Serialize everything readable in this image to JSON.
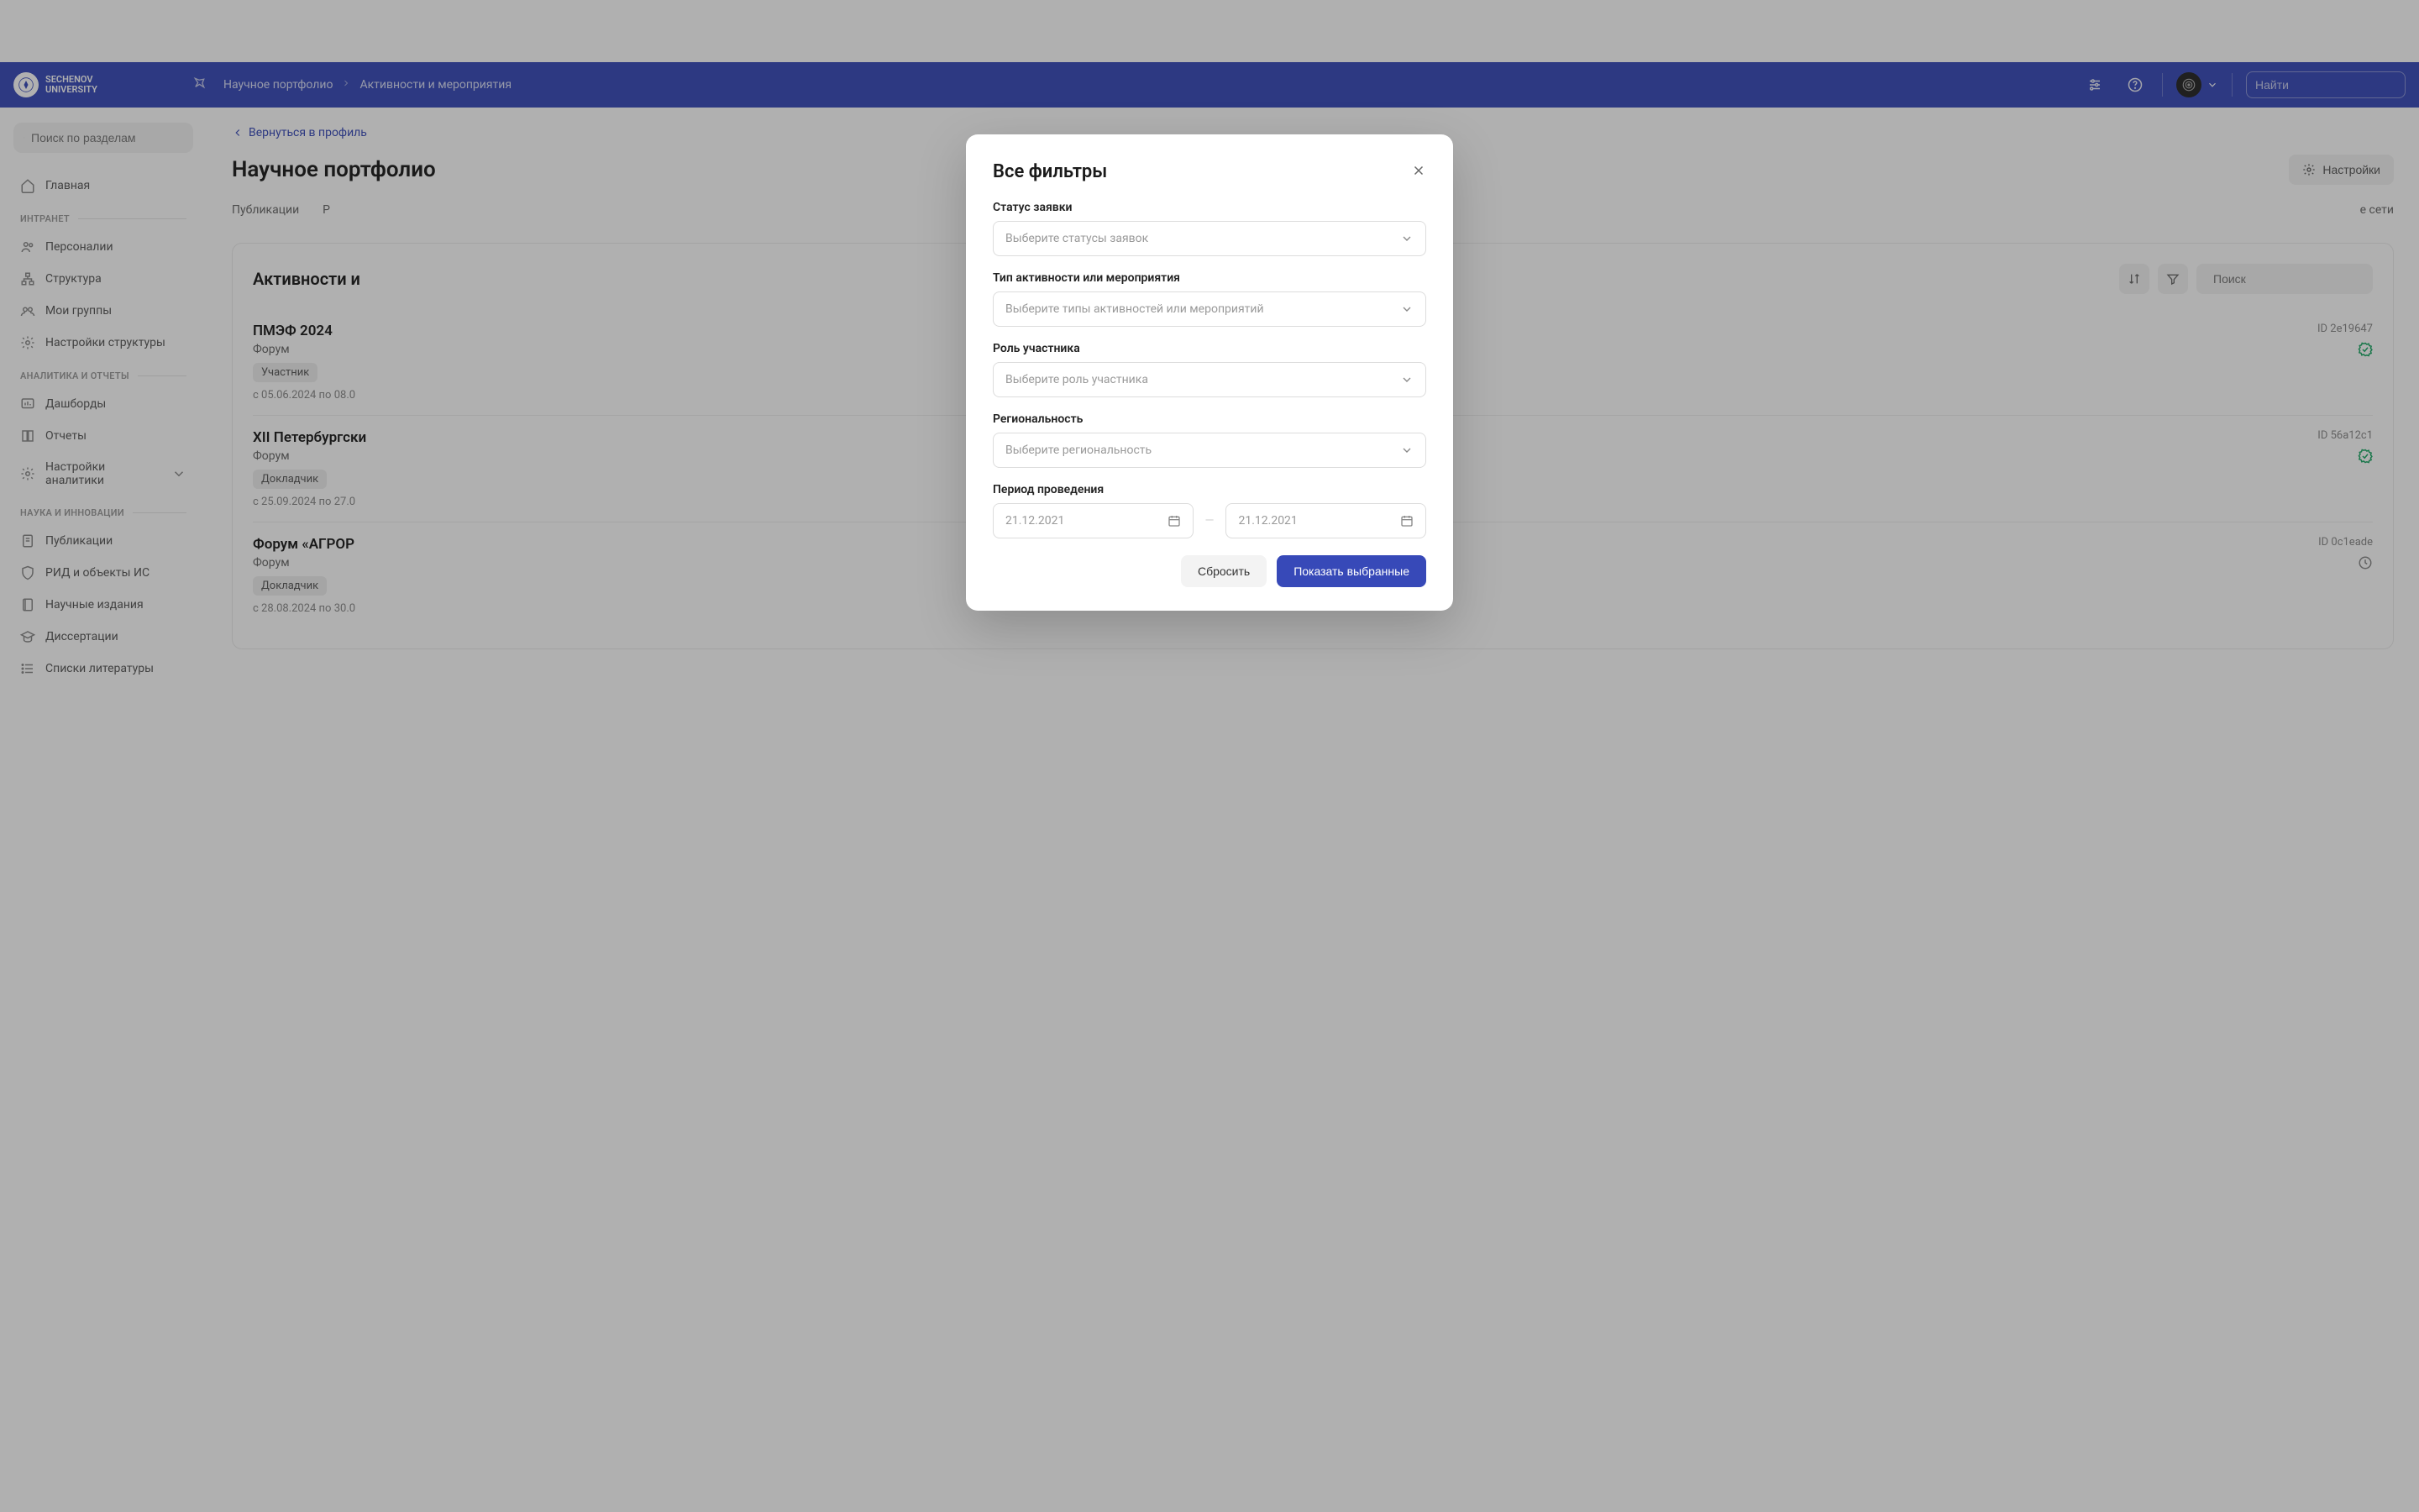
{
  "header": {
    "logo_line1": "SECHENOV",
    "logo_line2": "UNIVERSITY",
    "breadcrumbs": [
      "Научное портфолио",
      "Активности и мероприятия"
    ],
    "search_placeholder": "Найти"
  },
  "sidebar": {
    "search_placeholder": "Поиск по разделам",
    "items_top": [
      {
        "label": "Главная",
        "icon": "home"
      }
    ],
    "section_intranet": "ИНТРАНЕТ",
    "items_intranet": [
      {
        "label": "Персоналии",
        "icon": "users"
      },
      {
        "label": "Структура",
        "icon": "sitemap"
      },
      {
        "label": "Мои группы",
        "icon": "groups"
      },
      {
        "label": "Настройки структуры",
        "icon": "gear"
      }
    ],
    "section_analytics": "АНАЛИТИКА И ОТЧЕТЫ",
    "items_analytics": [
      {
        "label": "Дашборды",
        "icon": "dashboard"
      },
      {
        "label": "Отчеты",
        "icon": "book"
      },
      {
        "label": "Настройки аналитики",
        "icon": "gear",
        "expandable": true
      }
    ],
    "section_science": "НАУКА И ИННОВАЦИИ",
    "items_science": [
      {
        "label": "Публикации",
        "icon": "doc"
      },
      {
        "label": "РИД и объекты ИС",
        "icon": "shield"
      },
      {
        "label": "Научные издания",
        "icon": "journal"
      },
      {
        "label": "Диссертации",
        "icon": "grad"
      },
      {
        "label": "Списки литературы",
        "icon": "list"
      }
    ]
  },
  "main": {
    "back_label": "Вернуться в профиль",
    "page_title": "Научное портфолио",
    "settings_label": "Настройки",
    "tabs": [
      "Публикации",
      "Р",
      "е сети"
    ],
    "card_title": "Активности и",
    "card_search_placeholder": "Поиск",
    "events": [
      {
        "title": "ПМЭФ 2024",
        "type": "Форум",
        "badge": "Участник",
        "date": "с 05.06.2024 по 08.0",
        "id": "ID 2e19647",
        "status": "verified"
      },
      {
        "title": "XII Петербургски",
        "type": "Форум",
        "badge": "Докладчик",
        "date": "с 25.09.2024 по 27.0",
        "id": "ID 56a12c1",
        "status": "verified"
      },
      {
        "title": "Форум «АГРОР",
        "type": "Форум",
        "badge": "Докладчик",
        "date": "с 28.08.2024 по 30.0",
        "id": "ID 0c1eade",
        "status": "pending"
      }
    ]
  },
  "modal": {
    "title": "Все фильтры",
    "fields": {
      "status": {
        "label": "Статус заявки",
        "placeholder": "Выберите статусы заявок"
      },
      "type": {
        "label": "Тип активности или мероприятия",
        "placeholder": "Выберите типы активностей или мероприятий"
      },
      "role": {
        "label": "Роль участника",
        "placeholder": "Выберите роль участника"
      },
      "region": {
        "label": "Региональность",
        "placeholder": "Выберите региональность"
      },
      "period": {
        "label": "Период проведения",
        "date_placeholder": "21.12.2021"
      }
    },
    "reset_label": "Сбросить",
    "apply_label": "Показать выбранные"
  }
}
